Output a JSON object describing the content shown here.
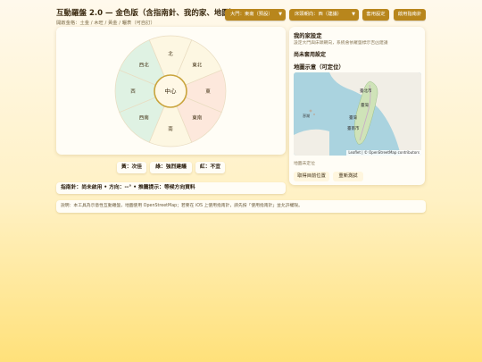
{
  "header": {
    "title": "互動羅盤 2.0 — 金色版（含指南針、我的家、地圖）",
    "subtitle": "開啟金格：土金 / 木旺 / 黃金 / 曬表（可自訂）"
  },
  "controls": {
    "door_select": "大門：東南（預設）",
    "bed_select": "床頭朝向：西（建議）",
    "apply_button": "套用設定",
    "compass_button": "啟用指南針"
  },
  "compass": {
    "center_label": "中心",
    "directions": [
      {
        "label": "北",
        "color": "yellow"
      },
      {
        "label": "東北",
        "color": "yellow"
      },
      {
        "label": "東",
        "color": "red"
      },
      {
        "label": "東南",
        "color": "red"
      },
      {
        "label": "南",
        "color": "yellow"
      },
      {
        "label": "西南",
        "color": "green"
      },
      {
        "label": "西",
        "color": "green"
      },
      {
        "label": "西北",
        "color": "green"
      }
    ],
    "colors": {
      "yellow": "#fdf7e2",
      "green": "#dff2e3",
      "red": "#fde8dc",
      "gold": "#c9a43c"
    }
  },
  "legend": {
    "yellow": "黃：次佳",
    "green": "綠：強烈建議",
    "red": "紅：不宜"
  },
  "status": "指南針：尚未啟用 • 方向：--° • 推薦提示：等候方向資料",
  "side": {
    "title": "我的家設定",
    "description": "設定大門與床頭朝向，系統會依羅盤標示吉凶建議",
    "state": "尚未套用設定",
    "map_title": "地圖示意（可定位）",
    "map_attribution": "Leaflet | © OpenStreetMap contributors",
    "map_labels": [
      "臺北市",
      "臺灣",
      "臺灣",
      "臺南市",
      "澎湖"
    ],
    "location_text": "地圖未定位",
    "locate_button": "取得目前位置",
    "move_button": "重新測試"
  },
  "note": "說明：本工具為示意性互動羅盤，地圖使用 OpenStreetMap；若要在 iOS 上使用指南針，請先按「使用指南針」並允許權限。"
}
